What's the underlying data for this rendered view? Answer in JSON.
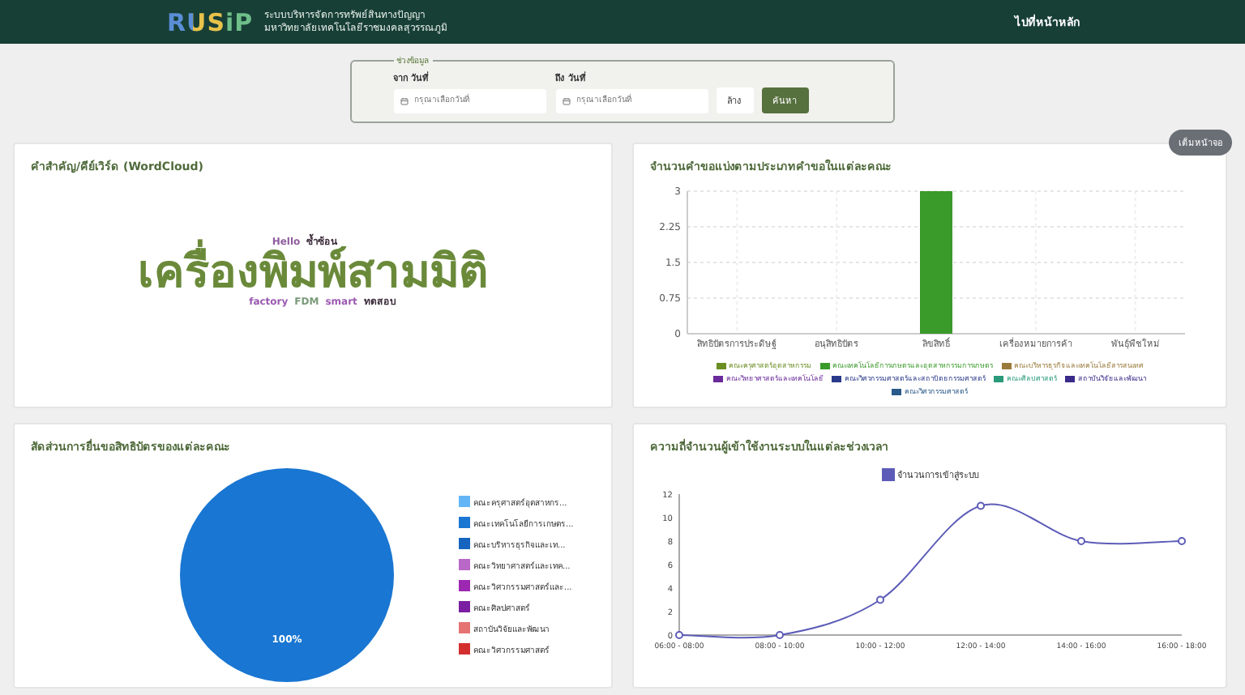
{
  "header": {
    "logo": "RUSiP",
    "subtitle_lines": [
      "ระบบบริหารจัดการทรัพย์สินทางปัญญา",
      "มหาวิทยาลัยเทคโนโลยีราชมงคลสุวรรณภูมิ"
    ],
    "home_link": "ไปที่หน้าหลัก"
  },
  "filter": {
    "legend": "ช่วงข้อมูล",
    "from_label": "จาก วันที่",
    "from_placeholder": "กรุณาเลือกวันที่",
    "to_label": "ถึง วันที่",
    "to_placeholder": "กรุณาเลือกวันที่",
    "buttons": [
      {
        "label": "ล้าง",
        "kind": "plain"
      },
      {
        "label": "ค้นหา",
        "kind": "primary"
      }
    ]
  },
  "fullscreen_button": "เต็มหน้าจอ",
  "wordcloud": {
    "title": "คำสำคัญ/คีย์เวิร์ด (WordCloud)",
    "words": [
      {
        "text": "Hello",
        "kind": "top",
        "color": "#8e5c9e"
      },
      {
        "text": "ซ้ำซ้อน",
        "kind": "top",
        "color": "#3a2a3a"
      },
      {
        "text": "เครื่องพิมพ์สามมิติ",
        "kind": "main",
        "color": "#6a8a3a"
      },
      {
        "text": "factory",
        "kind": "bottom",
        "color": "#9a5ab0"
      },
      {
        "text": "FDM",
        "kind": "bottom",
        "color": "#7a9a7a"
      },
      {
        "text": "smart",
        "kind": "bottom",
        "color": "#9a5ab0"
      },
      {
        "text": "ทดสอบ",
        "kind": "bottom",
        "color": "#3a2a3a"
      }
    ]
  },
  "bar_panel": {
    "title": "จำนวนคำขอแบ่งตามประเภทคำขอในแต่ละคณะ",
    "chart_data": {
      "type": "bar",
      "categories": [
        "สิทธิบัตรการประดิษฐ์",
        "อนุสิทธิบัตร",
        "ลิขสิทธิ์",
        "เครื่องหมายการค้า",
        "พันธุ์พืชใหม่"
      ],
      "grid": true,
      "ylim": [
        0,
        3
      ],
      "yticks": [
        0,
        0.75,
        1.5,
        2.25,
        3
      ],
      "series": [
        {
          "name": "คณะครุศาสตร์อุตสาหกรรม",
          "color": "#6b8e23",
          "values": [
            0,
            0,
            0,
            0,
            0
          ]
        },
        {
          "name": "คณะเทคโนโลยีการเกษตรและอุตสาหกรรมการเกษตร",
          "color": "#3a9a2a",
          "values": [
            0,
            0,
            3,
            0,
            0
          ]
        },
        {
          "name": "คณะบริหารธุรกิจและเทคโนโลยีสารสนเทศ",
          "color": "#9a7a3a",
          "values": [
            0,
            0,
            0,
            0,
            0
          ]
        },
        {
          "name": "คณะวิทยาศาสตร์และเทคโนโลยี",
          "color": "#6a2a9a",
          "values": [
            0,
            0,
            0,
            0,
            0
          ]
        },
        {
          "name": "คณะวิศวกรรมศาสตร์และสถาปัตยกรรมศาสตร์",
          "color": "#2a3a8a",
          "values": [
            0,
            0,
            0,
            0,
            0
          ]
        },
        {
          "name": "คณะศิลปศาสตร์",
          "color": "#2a9a7a",
          "values": [
            0,
            0,
            0,
            0,
            0
          ]
        },
        {
          "name": "สถาบันวิจัยและพัฒนา",
          "color": "#3a2a8a",
          "values": [
            0,
            0,
            0,
            0,
            0
          ]
        },
        {
          "name": "คณะวิศวกรรมศาสตร์",
          "color": "#2a5a8a",
          "values": [
            0,
            0,
            0,
            0,
            0
          ]
        }
      ]
    }
  },
  "pie_panel": {
    "title": "สัดส่วนการยื่นขอสิทธิบัตรของแต่ละคณะ",
    "chart_data": {
      "type": "pie",
      "categories": [
        "คณะครุศาสตร์อุตสาหกร...",
        "คณะเทคโนโลยีการเกษตร...",
        "คณะบริหารธุรกิจและเท...",
        "คณะวิทยาศาสตร์และเทค...",
        "คณะวิศวกรรมศาสตร์และ...",
        "คณะศิลปศาสตร์",
        "สถาบันวิจัยและพัฒนา",
        "คณะวิศวกรรมศาสตร์"
      ],
      "series": [
        {
          "colors": [
            "#64b5f6",
            "#1976d2",
            "#1565c0",
            "#ba68c8",
            "#9c27b0",
            "#7b1fa2",
            "#e57373",
            "#d32f2f"
          ],
          "values": [
            0,
            1,
            0,
            0,
            0,
            0,
            0,
            0
          ]
        }
      ],
      "value_labels": [
        null,
        "100%",
        null,
        null,
        null,
        null,
        null,
        null
      ]
    }
  },
  "line_panel": {
    "title": "ความถี่จำนวนผู้เข้าใช้งานระบบในแต่ละช่วงเวลา",
    "chart_data": {
      "type": "line",
      "categories": [
        "06:00 - 08:00",
        "08:00 - 10:00",
        "10:00 - 12:00",
        "12:00 - 14:00",
        "14:00 - 16:00",
        "16:00 - 18:00"
      ],
      "ylim": [
        0,
        12
      ],
      "yticks": [
        0,
        2,
        4,
        6,
        8,
        10,
        12
      ],
      "series": [
        {
          "name": "จำนวนการเข้าสู่ระบบ",
          "color": "#5c5cb8",
          "marker": "circle",
          "values": [
            0,
            0,
            3,
            11,
            8,
            8
          ]
        }
      ]
    }
  }
}
